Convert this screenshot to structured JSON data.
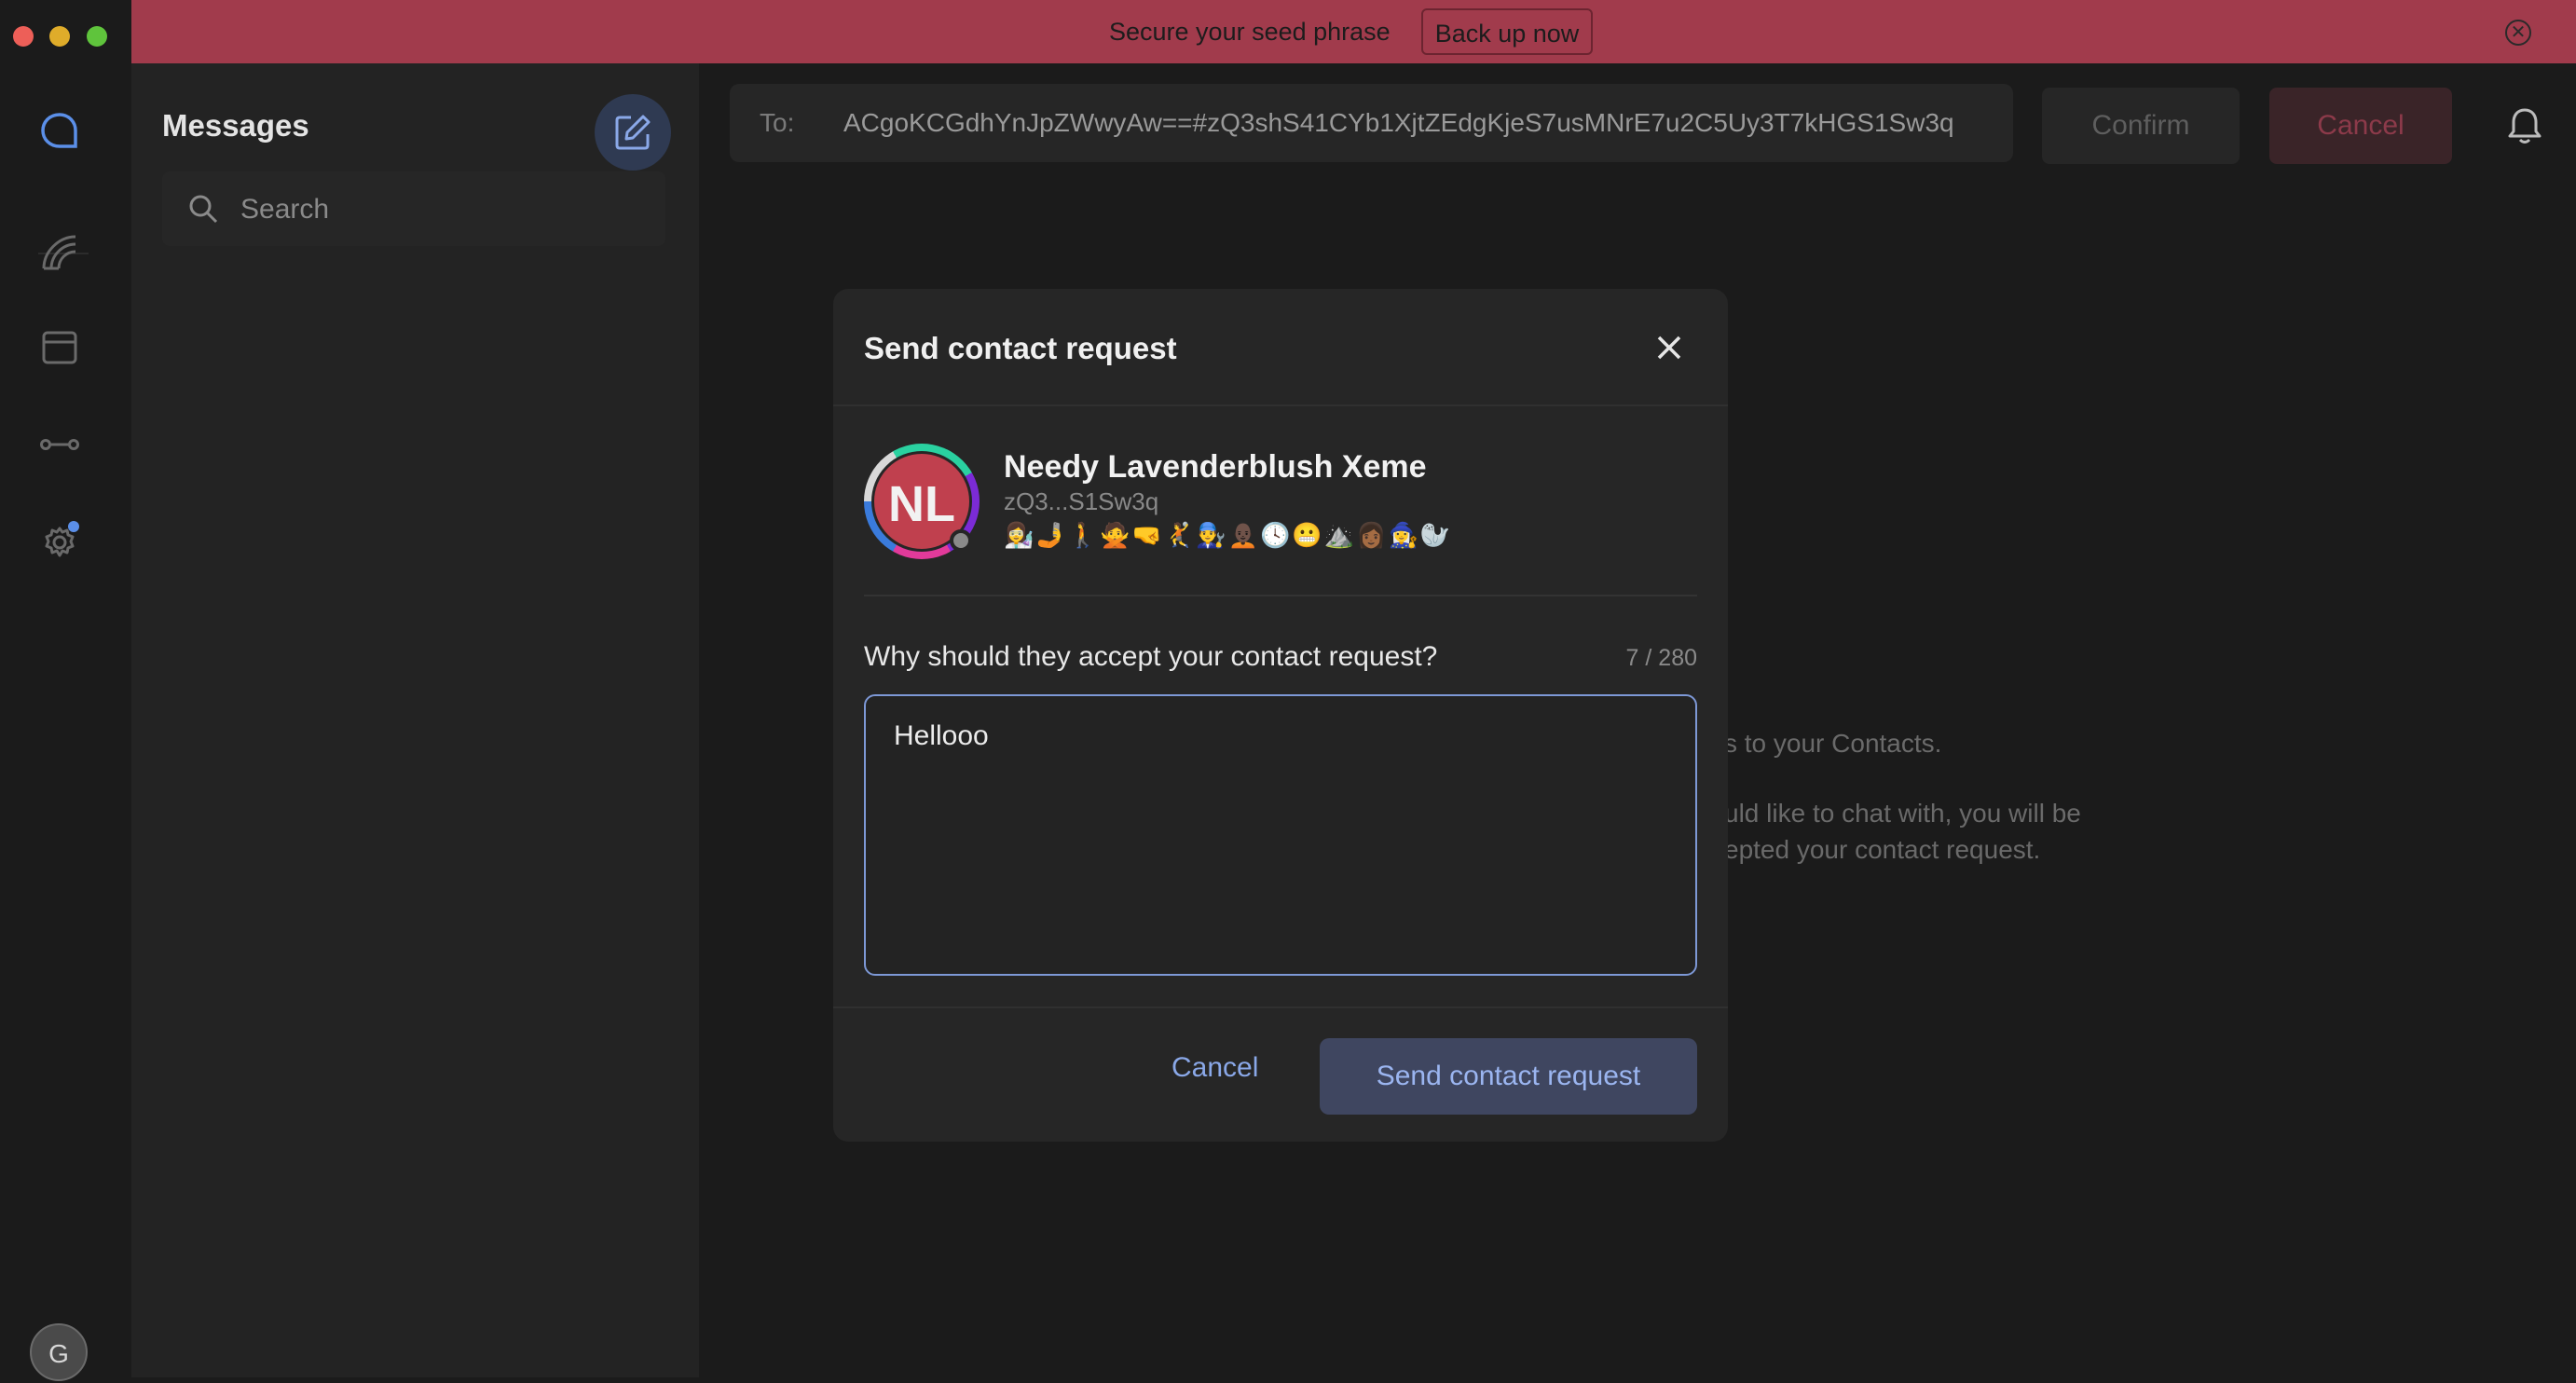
{
  "banner": {
    "message": "Secure your seed phrase",
    "action_label": "Back up now",
    "close_icon": "close-circle-icon",
    "color": "#a13b4c"
  },
  "sidebar": {
    "items": [
      {
        "name": "chat",
        "icon": "chat-bubble-icon"
      },
      {
        "name": "communities",
        "icon": "rainbow-icon"
      },
      {
        "name": "wallet",
        "icon": "wallet-icon"
      },
      {
        "name": "node",
        "icon": "link-icon"
      },
      {
        "name": "settings",
        "icon": "gear-icon"
      }
    ],
    "profile_initial": "G"
  },
  "messages": {
    "title": "Messages",
    "search_placeholder": "Search"
  },
  "chat_header": {
    "to_label": "To:",
    "to_value": "ACgoKCGdhYnJpZWwyAw==#zQ3shS41CYb1XjtZEdgKjeS7usMNrE7u2C5Uy3T7kHGS1Sw3q",
    "confirm_label": "Confirm",
    "cancel_label": "Cancel"
  },
  "background_text": {
    "line1": "s to your Contacts.",
    "line2": "uld like to chat with, you will be",
    "line3": "epted your contact request."
  },
  "modal": {
    "title": "Send contact request",
    "contact": {
      "initials": "NL",
      "name": "Needy Lavenderblush Xeme",
      "key": "zQ3...S1Sw3q",
      "emoji_hash": "👩‍🔬🤳🚶🙅🤜🤾👨‍🔧🧑🏿‍🦲🕓😬⛰️👩🏾🧙‍♀️🦭",
      "avatar_color": "#c0404e"
    },
    "reason_label": "Why should they accept your contact request?",
    "char_count": "7 / 280",
    "reason_value": "Hellooo",
    "cancel_label": "Cancel",
    "send_label": "Send contact request"
  }
}
